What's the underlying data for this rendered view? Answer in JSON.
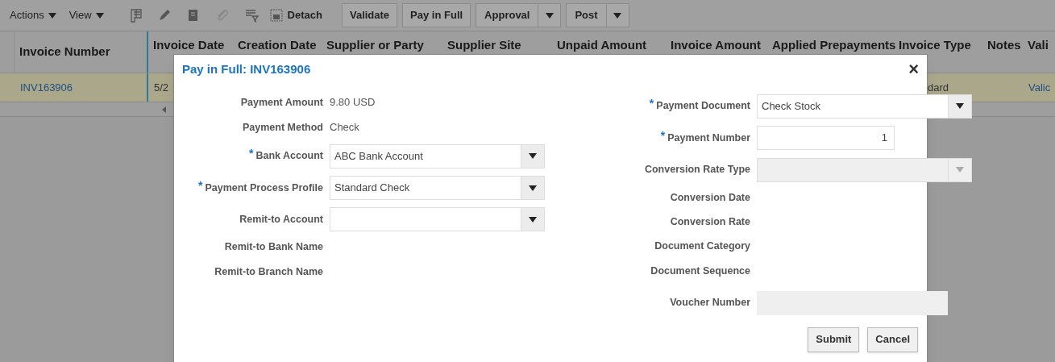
{
  "toolbar": {
    "menus": [
      "Actions",
      "View"
    ],
    "detach": "Detach",
    "buttons": [
      {
        "label": "Validate",
        "kind": "plain"
      },
      {
        "label": "Pay in Full",
        "kind": "plain"
      },
      {
        "label": "Approval",
        "kind": "split"
      },
      {
        "label": "Post",
        "kind": "split"
      }
    ]
  },
  "table": {
    "columns": [
      "Invoice Number",
      "Invoice Date",
      "Creation Date",
      "Supplier or Party",
      "Supplier Site",
      "Unpaid Amount",
      "Invoice Amount",
      "Applied Prepayments",
      "Invoice Type",
      "Notes",
      "Vali"
    ],
    "rows": [
      {
        "cells": [
          "INV163906",
          "5/2",
          "",
          "",
          "",
          "",
          "",
          "",
          "dard",
          "",
          "Valic"
        ],
        "selected": true
      }
    ]
  },
  "dialog": {
    "title": "Pay in Full: INV163906",
    "close": "×",
    "left_fields": [
      {
        "kind": "text",
        "label": "Payment Amount",
        "value": "9.80 USD"
      },
      {
        "kind": "text",
        "label": "Payment Method",
        "value": "Check"
      },
      {
        "kind": "select",
        "label": "Bank Account",
        "required_mark": "*",
        "value": "ABC Bank Account",
        "disabled": false
      },
      {
        "kind": "select",
        "label": "Payment Process Profile",
        "required_mark": "*",
        "value": "Standard Check",
        "disabled": false
      },
      {
        "kind": "select",
        "label": "Remit-to Account",
        "disabled": false
      },
      {
        "kind": "text",
        "label": "Remit-to Bank Name"
      },
      {
        "kind": "text",
        "label": "Remit-to Branch Name"
      }
    ],
    "right_fields": [
      {
        "kind": "select",
        "label": "Payment Document",
        "required_mark": "*",
        "value": "Check Stock",
        "disabled": false
      },
      {
        "kind": "number",
        "label": "Payment Number",
        "required_mark": "*",
        "value": "1"
      },
      {
        "kind": "select",
        "label": "Conversion Rate Type",
        "disabled": true
      },
      {
        "kind": "text",
        "label": "Conversion Date"
      },
      {
        "kind": "text",
        "label": "Conversion Rate"
      },
      {
        "kind": "text",
        "label": "Document Category"
      },
      {
        "kind": "text",
        "label": "Document Sequence"
      },
      {
        "kind": "readonly",
        "label": "Voucher Number"
      }
    ],
    "buttons": [
      "Submit",
      "Cancel"
    ]
  }
}
